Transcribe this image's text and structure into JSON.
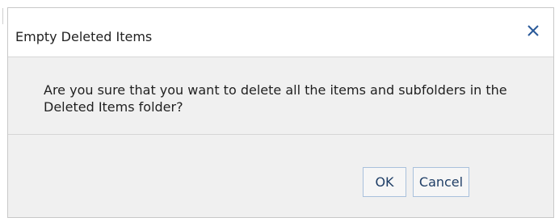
{
  "dialog": {
    "title": "Empty Deleted Items",
    "close_icon": "close-icon",
    "message": "Are you sure that you want to delete all the items and subfolders in the Deleted Items folder?",
    "buttons": {
      "ok_label": "OK",
      "cancel_label": "Cancel"
    }
  },
  "colors": {
    "body_background": "#f0f0f0",
    "button_border": "#a9c1dc",
    "button_text": "#1f3e66",
    "close_icon": "#2a5a9a"
  }
}
